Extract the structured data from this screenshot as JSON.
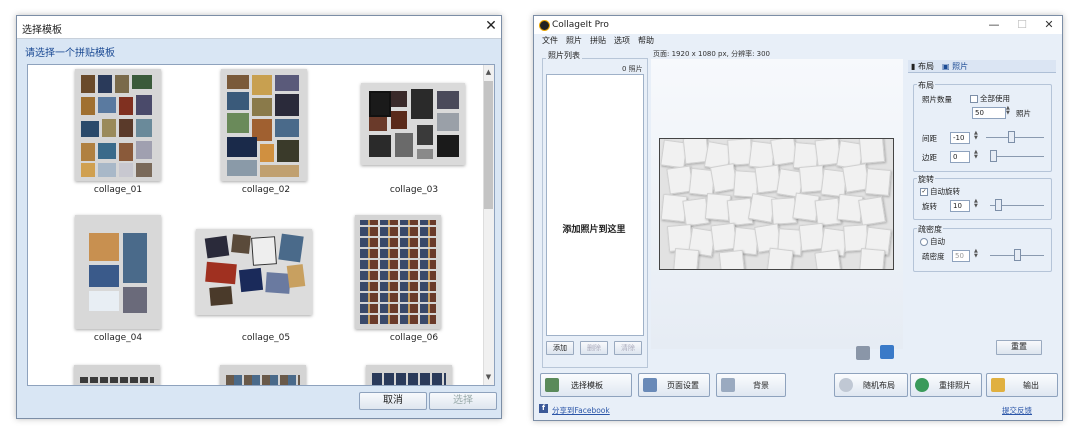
{
  "dialog": {
    "title": "选择模板",
    "close_glyph": "✕",
    "header": "请选择一个拼贴模板",
    "templates": [
      {
        "label": "collage_01"
      },
      {
        "label": "collage_02"
      },
      {
        "label": "collage_03"
      },
      {
        "label": "collage_04"
      },
      {
        "label": "collage_05"
      },
      {
        "label": "collage_06"
      }
    ],
    "cancel_label": "取消",
    "select_label": "选择"
  },
  "app": {
    "title": "CollageIt Pro",
    "menu": [
      "文件",
      "照片",
      "拼贴",
      "选项",
      "帮助"
    ],
    "photo_list_label": "照片列表",
    "photo_count": "0 照片",
    "add_here": "添加照片到这里",
    "list_buttons": {
      "add": "添加",
      "delete": "删除",
      "clear": "清除"
    },
    "page_info": "页面: 1920 x 1080 px, 分辨率: 300",
    "tabs": {
      "layout": "布局",
      "photo": "照片"
    },
    "layout_group": {
      "title": "布局",
      "photo_count_label": "照片数量",
      "use_all_label": "全部使用",
      "photo_count_value": "50",
      "photo_unit": "照片",
      "spacing_label": "间距",
      "spacing_value": "-10",
      "margin_label": "边距",
      "margin_value": "0"
    },
    "rotation_group": {
      "title": "旋转",
      "auto_label": "自动旋转",
      "rotate_label": "旋转",
      "rotate_value": "10"
    },
    "density_group": {
      "title": "疏密度",
      "auto_label": "自动",
      "density_label": "疏密度",
      "density_value": "50"
    },
    "reset_label": "重置",
    "bottom_buttons": {
      "choose_template": "选择模板",
      "page_setup": "页面设置",
      "background": "背景",
      "random_layout": "随机布局",
      "shuffle": "重排照片",
      "output": "输出"
    },
    "share_label": "分享到Facebook",
    "feedback_label": "提交反馈"
  }
}
